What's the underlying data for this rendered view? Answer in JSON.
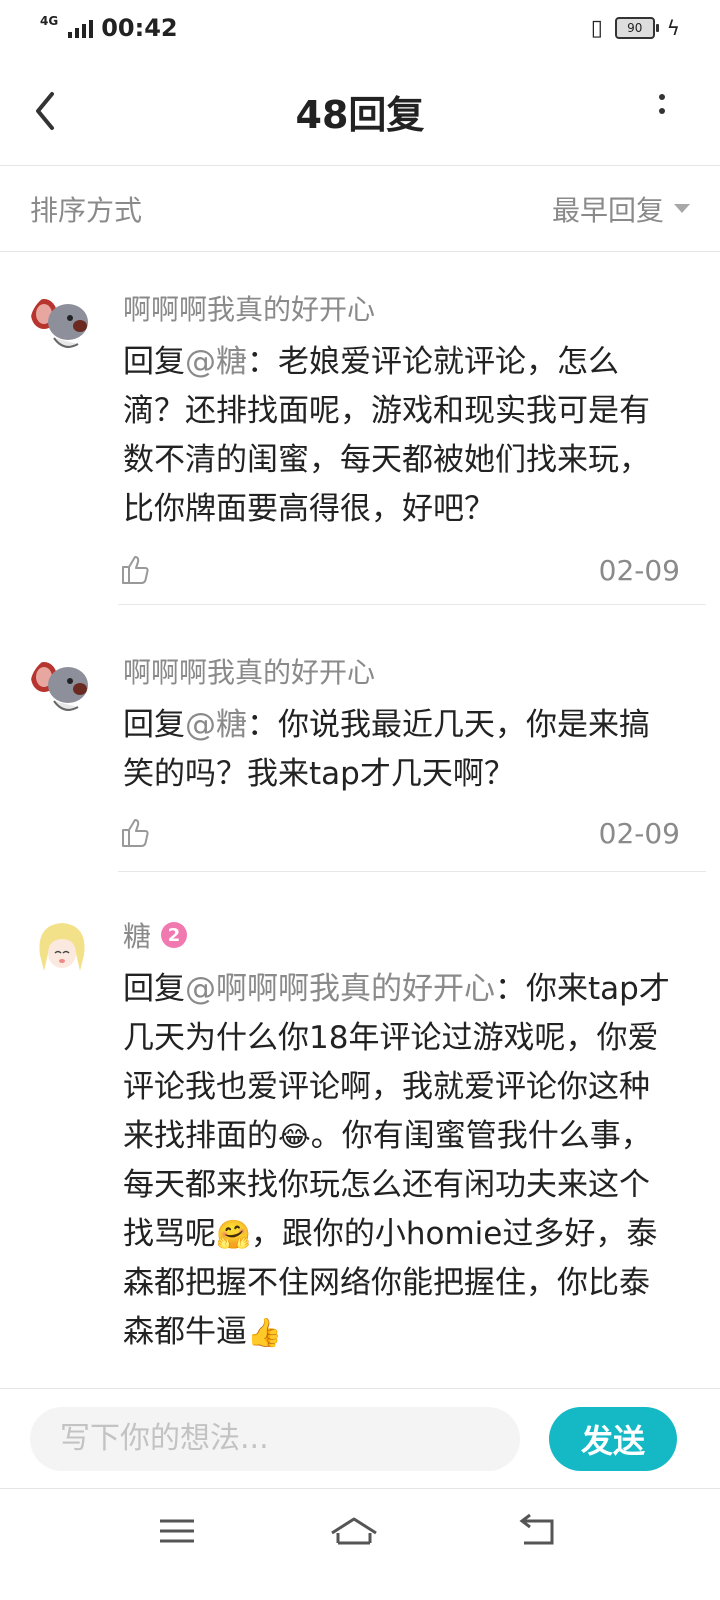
{
  "status_bar": {
    "network": "4G",
    "time": "00:42",
    "battery": "90"
  },
  "header": {
    "title": "48回复"
  },
  "sort": {
    "label": "排序方式",
    "value": "最早回复"
  },
  "comments": [
    {
      "username": "啊啊啊我真的好开心",
      "reply_prefix": "回复",
      "mention": "@糖",
      "text": "：老娘爱评论就评论，怎么滴？还排找面呢，游戏和现实我可是有数不清的闺蜜，每天都被她们找来玩，比你牌面要高得很，好吧？",
      "date": "02-09"
    },
    {
      "username": "啊啊啊我真的好开心",
      "reply_prefix": "回复",
      "mention": "@糖",
      "text": "：你说我最近几天，你是来搞笑的吗？我来tap才几天啊？",
      "date": "02-09"
    },
    {
      "username": "糖",
      "badge": "2",
      "reply_prefix": "回复",
      "mention": "@啊啊啊我真的好开心",
      "text_1": "：你来tap才几天为什么你18年评论过游戏呢，你爱评论我也爱评论啊，我就爱评论你这种来找排面的",
      "emoji_1": "😂",
      "text_2": "。你有闺蜜管我什么事，每天都来找你玩怎么还有闲功夫来这个找骂呢",
      "emoji_2": "🤗",
      "text_3": "，跟你的小homie过多好，泰森都把握不住网络你能把握住，你比泰森都牛逼",
      "emoji_3": "👍"
    }
  ],
  "input": {
    "placeholder": "写下你的想法..."
  },
  "send_button": {
    "label": "发送"
  }
}
